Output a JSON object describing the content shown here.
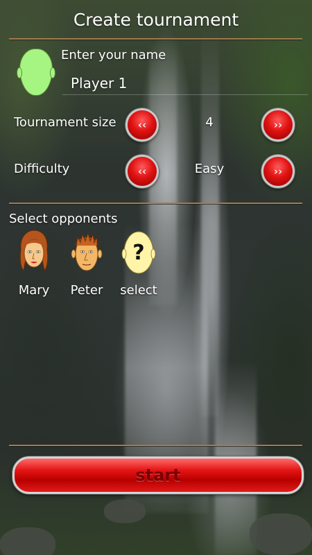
{
  "screen": {
    "title": "Create tournament"
  },
  "player": {
    "name_label": "Enter your name",
    "name_value": "Player 1",
    "avatar_color": "#a6f482"
  },
  "settings": {
    "tournament_size": {
      "label": "Tournament size",
      "value": "4",
      "decrease_glyph": "‹‹",
      "increase_glyph": "››"
    },
    "difficulty": {
      "label": "Difficulty",
      "value": "Easy",
      "decrease_glyph": "‹‹",
      "increase_glyph": "››"
    }
  },
  "opponents": {
    "label": "Select opponents",
    "items": [
      {
        "name": "Mary",
        "icon": "female-face-icon"
      },
      {
        "name": "Peter",
        "icon": "male-face-icon"
      },
      {
        "name": "select",
        "icon": "question-face-icon",
        "symbol": "?"
      }
    ]
  },
  "actions": {
    "start_label": "start"
  },
  "colors": {
    "accent_red": "#e01212",
    "divider": "#a57a4f",
    "placeholder_face": "#fff4a8"
  }
}
